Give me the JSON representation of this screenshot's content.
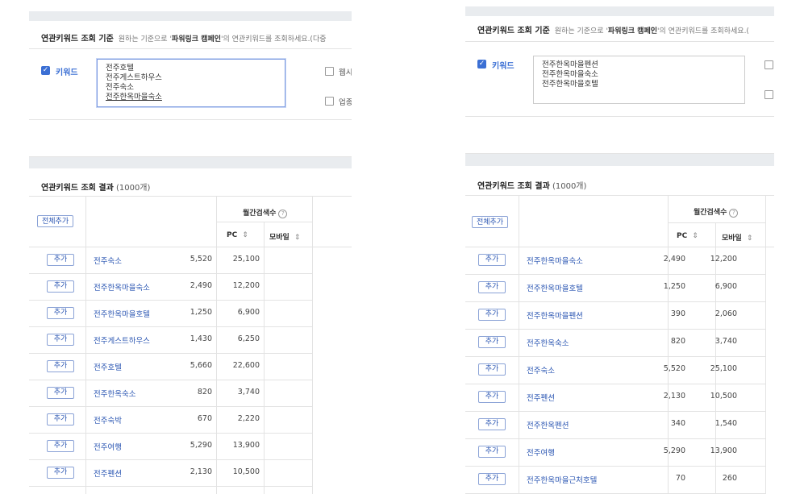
{
  "criteria_title": "연관키워드 조회 기준",
  "criteria_desc_prefix": "원하는 기준으로 '",
  "criteria_desc_bold": "파워링크 캠페인",
  "left": {
    "criteria_desc_suffix": "'의 연관키워드를 조회하세요.(다중",
    "keyword_label": "키워드",
    "keywords": [
      "전주호텔",
      "전주게스트하우스",
      "전주숙소",
      "전주한옥마을숙소"
    ],
    "option_website": "웹시",
    "option_business": "업종",
    "result_title": "연관키워드 조회 결과",
    "result_count": "(1000개)",
    "add_all_label": "전체추가",
    "monthly_search_label": "월간검색수",
    "pc_label": "PC",
    "mobile_label": "모바일",
    "add_label": "추가",
    "rows": [
      {
        "keyword": "전주숙소",
        "pc": "5,520",
        "mobile": "25,100"
      },
      {
        "keyword": "전주한옥마을숙소",
        "pc": "2,490",
        "mobile": "12,200"
      },
      {
        "keyword": "전주한옥마을호텔",
        "pc": "1,250",
        "mobile": "6,900"
      },
      {
        "keyword": "전주게스트하우스",
        "pc": "1,430",
        "mobile": "6,250"
      },
      {
        "keyword": "전주호텔",
        "pc": "5,660",
        "mobile": "22,600"
      },
      {
        "keyword": "전주한옥숙소",
        "pc": "820",
        "mobile": "3,740"
      },
      {
        "keyword": "전주숙박",
        "pc": "670",
        "mobile": "2,220"
      },
      {
        "keyword": "전주여행",
        "pc": "5,290",
        "mobile": "13,900"
      },
      {
        "keyword": "전주펜션",
        "pc": "2,130",
        "mobile": "10,500"
      }
    ]
  },
  "right": {
    "criteria_desc_suffix": "'의 연관키워드를 조회하세요.(",
    "keyword_label": "키워드",
    "keywords": [
      "전주한옥마을펜션",
      "전주한옥마을숙소",
      "전주한옥마을호텔"
    ],
    "result_title": "연관키워드 조회 결과",
    "result_count": "(1000개)",
    "add_all_label": "전체추가",
    "monthly_search_label": "월간검색수",
    "pc_label": "PC",
    "mobile_label": "모바일",
    "add_label": "추가",
    "rows": [
      {
        "keyword": "전주한옥마을숙소",
        "pc": "2,490",
        "mobile": "12,200"
      },
      {
        "keyword": "전주한옥마을호텔",
        "pc": "1,250",
        "mobile": "6,900"
      },
      {
        "keyword": "전주한옥마을펜션",
        "pc": "390",
        "mobile": "2,060"
      },
      {
        "keyword": "전주한옥숙소",
        "pc": "820",
        "mobile": "3,740"
      },
      {
        "keyword": "전주숙소",
        "pc": "5,520",
        "mobile": "25,100"
      },
      {
        "keyword": "전주펜션",
        "pc": "2,130",
        "mobile": "10,500"
      },
      {
        "keyword": "전주한옥펜션",
        "pc": "340",
        "mobile": "1,540"
      },
      {
        "keyword": "전주여행",
        "pc": "5,290",
        "mobile": "13,900"
      },
      {
        "keyword": "전주한옥마을근처호텔",
        "pc": "70",
        "mobile": "260"
      }
    ]
  }
}
